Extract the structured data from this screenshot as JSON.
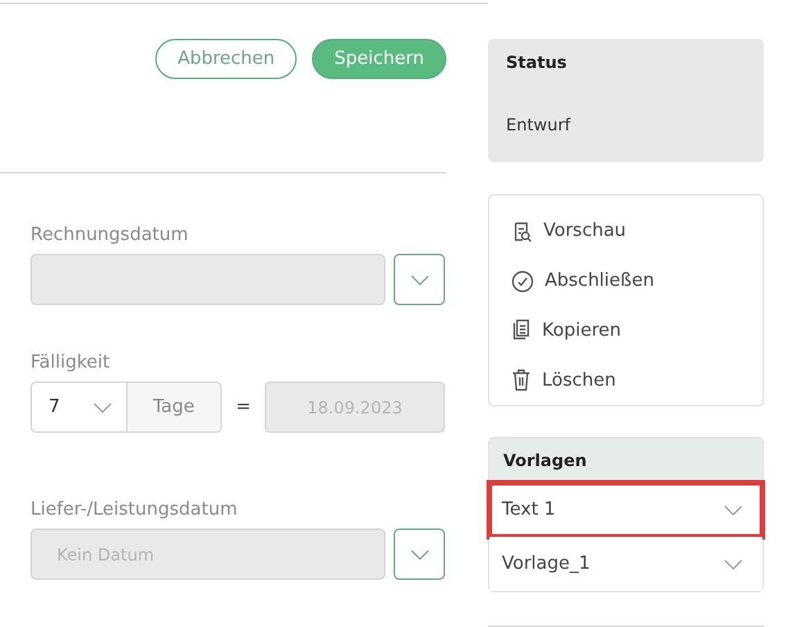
{
  "buttons": [
    {
      "label": "Abbrechen",
      "kind": "outline"
    },
    {
      "label": "Speichern",
      "kind": "primary"
    }
  ],
  "form": {
    "invoice_date": {
      "label": "Rechnungsdatum"
    },
    "due": {
      "label": "Fälligkeit",
      "days": "7",
      "unit": "Tage",
      "equals": "=",
      "date": "18.09.2023"
    },
    "delivery_date": {
      "label": "Liefer-/Leistungsdatum",
      "placeholder": "Kein Datum"
    }
  },
  "status": {
    "title": "Status",
    "value": "Entwurf"
  },
  "actions": [
    {
      "label": "Vorschau",
      "kind": "preview"
    },
    {
      "label": "Abschließen",
      "kind": "complete"
    },
    {
      "label": "Kopieren",
      "kind": "copy"
    },
    {
      "label": "Löschen",
      "kind": "delete"
    }
  ],
  "templates": {
    "title": "Vorlagen",
    "items": [
      {
        "value": "Text 1",
        "highlighted": true
      },
      {
        "value": "Vorlage_1",
        "highlighted": false
      }
    ]
  }
}
